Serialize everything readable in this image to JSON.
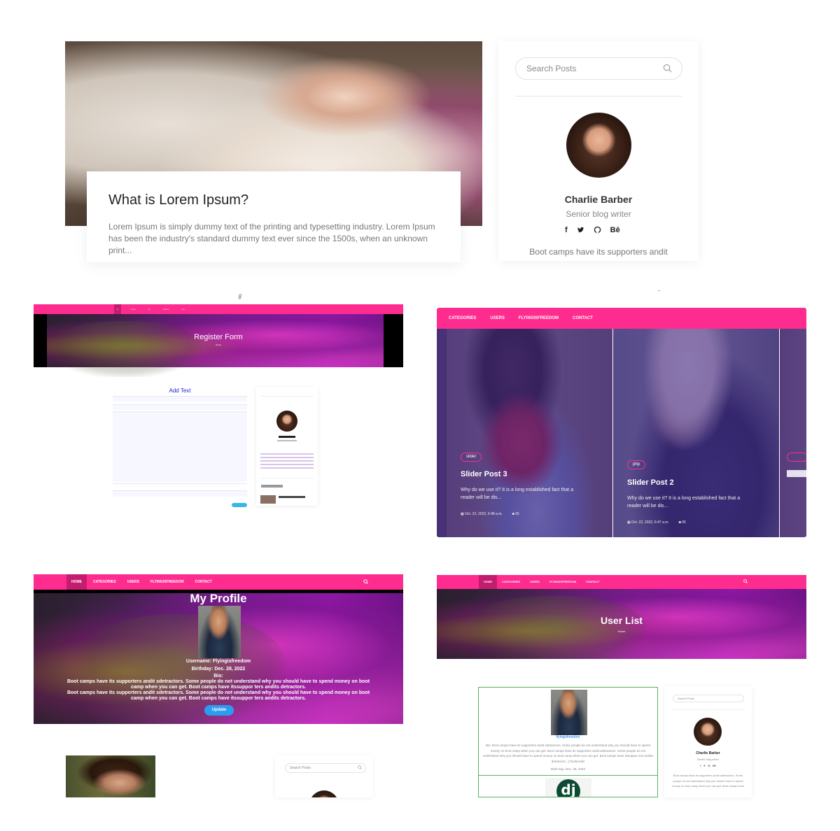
{
  "panel_blog": {
    "post_title": "What is Lorem Ipsum?",
    "post_excerpt": "Lorem Ipsum is simply dummy text of the printing and typesetting industry. Lorem Ipsum has been the industry's standard dummy text ever since the 1500s, when an unknown print...",
    "search_placeholder": "Search Posts",
    "author_name": "Charlie Barber",
    "author_role": "Senior blog writer",
    "social_icons": [
      "facebook-icon",
      "twitter-icon",
      "github-icon",
      "behance-icon"
    ],
    "behance_label": "Bē",
    "author_bio": "Boot camps have its supporters andit"
  },
  "panel_register": {
    "hero_title": "Register Form",
    "breadcrumb": "Home",
    "form_heading": "Add Text"
  },
  "panel_slider": {
    "nav": [
      "CATEGORIES",
      "USERS",
      "FLYINGISFREEDOM",
      "CONTACT"
    ],
    "slides": [
      {
        "tag": "slider",
        "title": "Slider Post 3",
        "text": "Why do we use it? It is a long established fact that a reader will be dis...",
        "date": "Oct. 22, 2022, 6:48 a.m.",
        "comments": "05"
      },
      {
        "tag": "php",
        "title": "Slider Post 2",
        "text": "Why do we use it? It is a long established fact that a reader will be dis...",
        "date": "Oct. 22, 2022, 6:47 a.m.",
        "comments": "05"
      }
    ]
  },
  "panel_profile": {
    "nav": [
      "HOME",
      "CATEGORIES",
      "USERS",
      "FLYINGISFREEDOM",
      "CONTACT"
    ],
    "active_nav": "HOME",
    "title": "My Profile",
    "username": "Username: Flyingisfreedom",
    "birthday": "Birthday: Dec. 28, 2022",
    "bio_label": "Bio:",
    "bio_1": "Boot camps have its supporters andit sdetractors. Some people do not understand why you should have to spend money on boot camp when you can get. Boot camps have itssuppor ters andits detractors.",
    "bio_2": "Boot camps have its supporters andit sdetractors. Some people do not understand why you should have to spend money on boot camp when you can get. Boot camps have itssuppor ters andits detractors.",
    "update_button": "Update"
  },
  "panel_userlist": {
    "nav": [
      "HOME",
      "CATEGORIES",
      "USERS",
      "FLYINGISFREEDOM",
      "CONTACT"
    ],
    "title": "User List",
    "breadcrumb": "Home",
    "username": "flyingisfreedom",
    "bio": "Bio: Boot camps have its supporters andit sdetractors. Some people do not understand why you should have to spend money on boot camp when you can get. Boot camps have its supporters andit sdetractors. Some people do not understand why you should have to spend money on boot camp when you can get. Boot camps have itssuppor ters andits detractors. :) fmebreaks",
    "birth_day": "Birth Day: Dec. 28, 2022",
    "dj_logo": "dj",
    "search_placeholder": "Search Posts",
    "author_name": "Charlie Barber",
    "author_role": "Senior blog writer",
    "author_bio": "Boot camps have its supporters andit sdetractors. Some people do not understand why you should have to spend money on boot camp when you can get. Boot camps have"
  },
  "panel_partial": {
    "search_placeholder": "Search Posts"
  },
  "colors": {
    "brand_pink": "#ff2c8f",
    "update_blue": "#2d9cf0",
    "link_blue": "#1a73e8"
  }
}
